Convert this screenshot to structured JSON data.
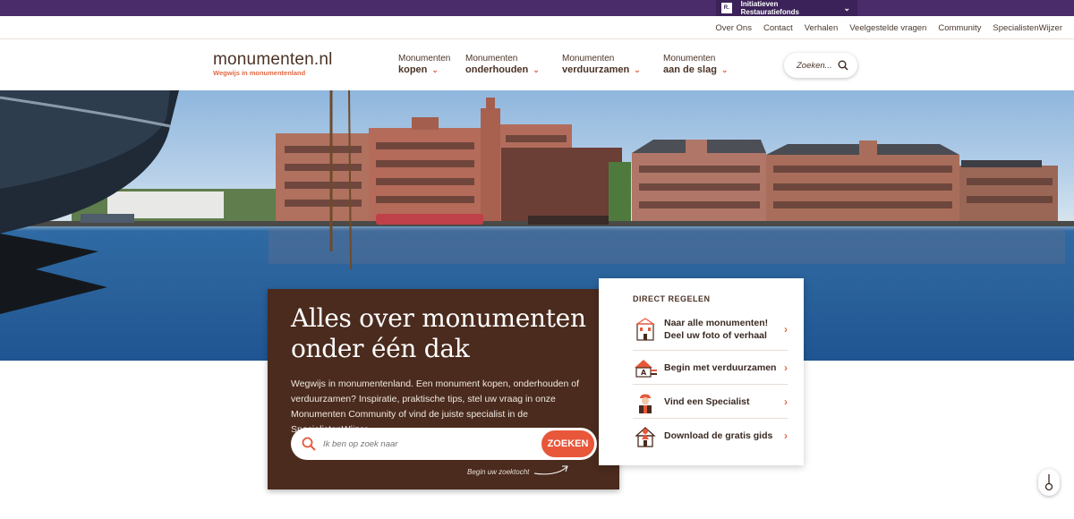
{
  "topbar": {
    "label": "Initiatieven Restauratiefonds",
    "logo_text": "R."
  },
  "utility_nav": [
    "Over Ons",
    "Contact",
    "Verhalen",
    "Veelgestelde vragen",
    "Community",
    "SpecialistenWijzer"
  ],
  "logo": {
    "name": "monumenten.nl",
    "tagline": "Wegwijs in monumentenland"
  },
  "main_nav": [
    {
      "line1": "Monumenten",
      "line2": "kopen"
    },
    {
      "line1": "Monumenten",
      "line2": "onderhouden"
    },
    {
      "line1": "Monumenten",
      "line2": "verduurzamen"
    },
    {
      "line1": "Monumenten",
      "line2": "aan de slag"
    }
  ],
  "search": {
    "label": "Zoeken..."
  },
  "hero_card": {
    "title": "Alles over monumenten onder één dak",
    "body": "Wegwijs in monumentenland. Een monument kopen, onderhouden of verduurzamen? Inspiratie, praktische tips, stel uw vraag in onze Monumenten Community of vind de juiste specialist in de SpecialistenWijzer.",
    "search_placeholder": "Ik ben op zoek naar",
    "search_button": "ZOEKEN",
    "hint": "Begin uw zoektocht"
  },
  "direct": {
    "heading": "DIRECT REGELEN",
    "items": [
      {
        "label": "Naar alle monumenten! Deel uw foto of verhaal",
        "icon": "monument-building-icon"
      },
      {
        "label": "Begin met verduurzamen",
        "icon": "energy-label-house-icon"
      },
      {
        "label": "Vind een Specialist",
        "icon": "specialist-worker-icon"
      },
      {
        "label": "Download de gratis gids",
        "icon": "guide-house-icon"
      }
    ]
  },
  "colors": {
    "brand_purple": "#4a2c6b",
    "brown": "#4a2b1e",
    "accent": "#e8573a"
  }
}
